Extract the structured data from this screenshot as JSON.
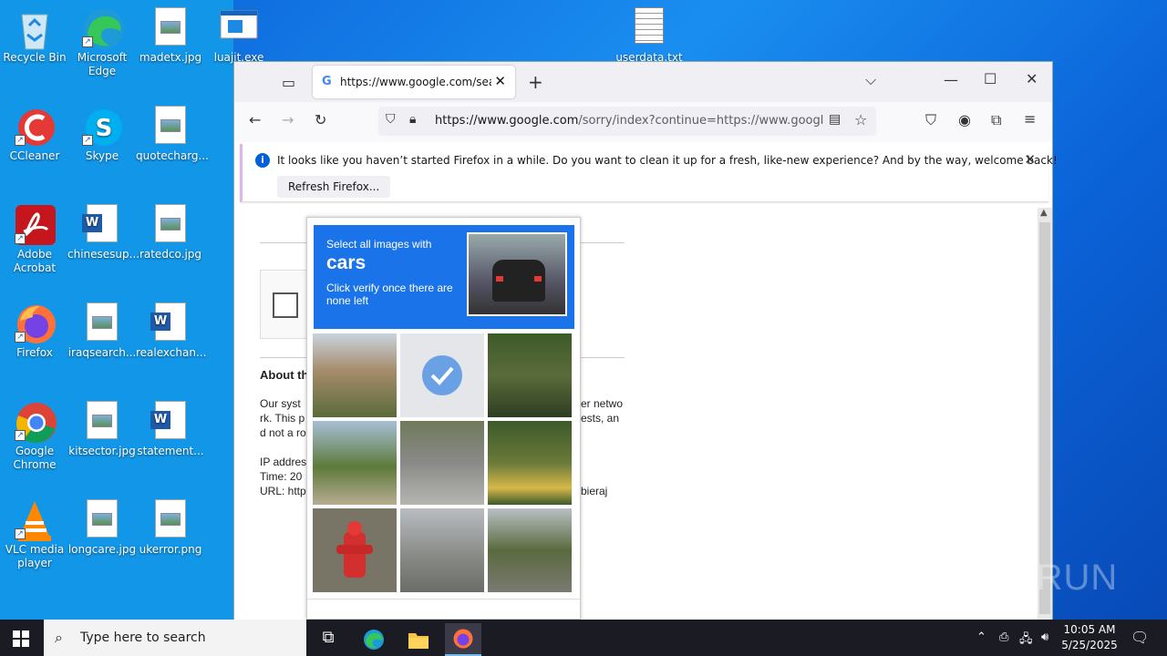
{
  "desktop": {
    "icons": [
      {
        "label": "Recycle Bin",
        "icon": "recycle-bin-icon"
      },
      {
        "label": "Microsoft Edge",
        "icon": "edge-icon"
      },
      {
        "label": "madetx.jpg",
        "icon": "image-file-icon"
      },
      {
        "label": "luajit.exe",
        "icon": "exe-file-icon"
      },
      {
        "label": "userdata.txt",
        "icon": "text-file-icon"
      },
      {
        "label": "CCleaner",
        "icon": "ccleaner-icon"
      },
      {
        "label": "Skype",
        "icon": "skype-icon"
      },
      {
        "label": "quotecharg...",
        "icon": "image-file-icon"
      },
      {
        "label": "Adobe Acrobat",
        "icon": "acrobat-icon"
      },
      {
        "label": "chinesesup...",
        "icon": "word-file-icon"
      },
      {
        "label": "ratedco.jpg",
        "icon": "image-file-icon"
      },
      {
        "label": "Firefox",
        "icon": "firefox-icon"
      },
      {
        "label": "iraqsearch...",
        "icon": "image-file-icon"
      },
      {
        "label": "realexchan...",
        "icon": "word-file-icon"
      },
      {
        "label": "Google Chrome",
        "icon": "chrome-icon"
      },
      {
        "label": "kitsector.jpg",
        "icon": "image-file-icon"
      },
      {
        "label": "statement...",
        "icon": "word-file-icon"
      },
      {
        "label": "VLC media player",
        "icon": "vlc-icon"
      },
      {
        "label": "longcare.jpg",
        "icon": "image-file-icon"
      },
      {
        "label": "ukerror.png",
        "icon": "image-file-icon"
      }
    ]
  },
  "browser": {
    "tab_title": "https://www.google.com/search",
    "url_domain": "https://www.google.com",
    "url_rest": "/sorry/index?continue=https://www.google.com",
    "notification": {
      "message": "It looks like you haven’t started Firefox in a while. Do you want to clean it up for a fresh, like-new experience? And by the way, welcome back!",
      "button": "Refresh Firefox..."
    },
    "page": {
      "about_heading": "About th",
      "line1": "Our syst",
      "line1_right": "er netwo",
      "line2": "rk. This p",
      "line2_right": "ests, an",
      "line3": "d not a ro",
      "ip_label": "IP addres",
      "time_label": "Time: 20",
      "url_label": "URL: http",
      "url_right": "bieraj"
    }
  },
  "captcha": {
    "instruction_line1": "Select all images with",
    "target": "cars",
    "instruction_line3": "Click verify once there are none left",
    "tiles_selected": [
      false,
      true,
      false,
      false,
      false,
      false,
      false,
      false,
      false
    ]
  },
  "taskbar": {
    "search_placeholder": "Type here to search",
    "time": "10:05 AM",
    "date": "5/25/2025"
  },
  "watermark": "ANY RUN"
}
